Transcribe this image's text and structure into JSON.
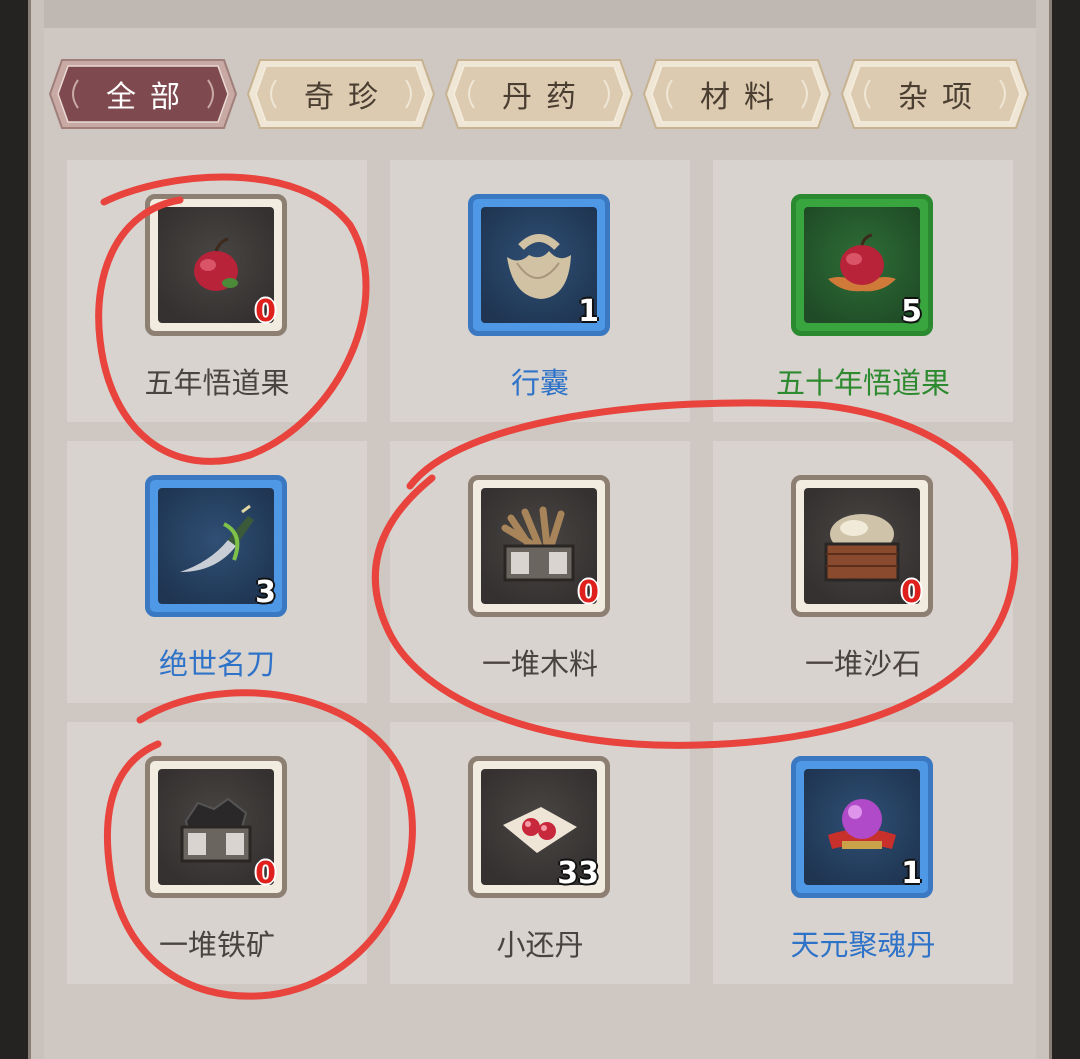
{
  "tabs": [
    {
      "label": "全部",
      "active": true
    },
    {
      "label": "奇珍",
      "active": false
    },
    {
      "label": "丹药",
      "active": false
    },
    {
      "label": "材料",
      "active": false
    },
    {
      "label": "杂项",
      "active": false
    }
  ],
  "items": [
    {
      "name": "五年悟道果",
      "count": "0",
      "quality": "gray",
      "icon": "red-fruit-icon"
    },
    {
      "name": "行囊",
      "count": "1",
      "quality": "blue",
      "icon": "cloth-bundle-icon"
    },
    {
      "name": "五十年悟道果",
      "count": "5",
      "quality": "green",
      "icon": "lotus-fruit-icon"
    },
    {
      "name": "绝世名刀",
      "count": "3",
      "quality": "blue",
      "icon": "blade-icon"
    },
    {
      "name": "一堆木料",
      "count": "0",
      "quality": "gray",
      "icon": "wood-crate-icon"
    },
    {
      "name": "一堆沙石",
      "count": "0",
      "quality": "gray",
      "icon": "sand-crate-icon"
    },
    {
      "name": "一堆铁矿",
      "count": "0",
      "quality": "gray",
      "icon": "iron-ore-crate-icon"
    },
    {
      "name": "小还丹",
      "count": "33",
      "quality": "gray",
      "icon": "red-pills-icon"
    },
    {
      "name": "天元聚魂丹",
      "count": "1",
      "quality": "blue",
      "icon": "purple-orb-icon"
    }
  ],
  "colors": {
    "tab_active": "#7e4a4f",
    "tab_inactive": "#dccbb0",
    "quality_blue": "#4f98e6",
    "quality_green": "#39a53f",
    "annotation_red": "#e8433d"
  }
}
